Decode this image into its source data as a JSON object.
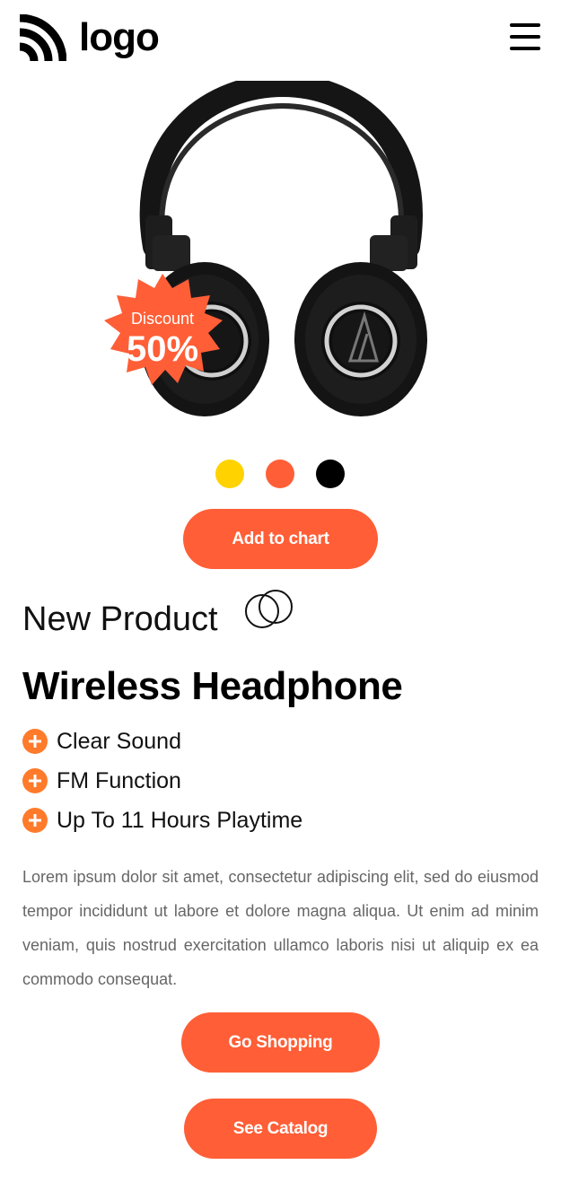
{
  "header": {
    "logo_text": "logo",
    "logo_icon": "wifi-arcs-icon",
    "menu_icon": "hamburger-menu-icon"
  },
  "product": {
    "image_icon": "headphones-image",
    "badge": {
      "label": "Discount",
      "value": "50%"
    },
    "colors": [
      "#ffd200",
      "#ff5e36",
      "#000000"
    ]
  },
  "actions": {
    "add_to_cart": "Add to chart",
    "go_shopping": "Go Shopping",
    "see_catalog": "See Catalog"
  },
  "info": {
    "eyebrow": "New Product",
    "title": "Wireless Headphone",
    "features": [
      "Clear Sound",
      "FM Function",
      "Up To 11 Hours Playtime"
    ],
    "description": "Lorem ipsum dolor sit amet, consectetur adipiscing elit, sed do eiusmod tempor incididunt ut labore et dolore magna aliqua. Ut enim ad minim veniam, quis nostrud exercitation ullamco laboris nisi ut aliquip ex ea commodo consequat."
  },
  "theme": {
    "accent": "#ff5e36",
    "feature_icon_color": "#ff7a2a"
  }
}
